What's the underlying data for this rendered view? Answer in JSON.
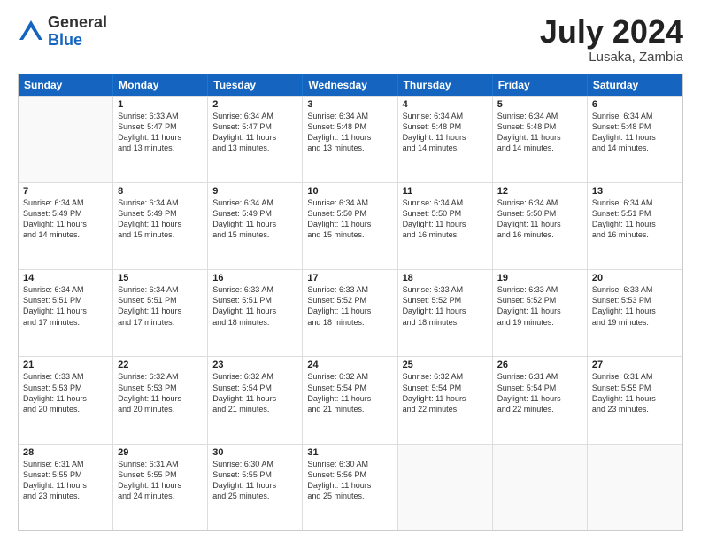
{
  "header": {
    "logo_general": "General",
    "logo_blue": "Blue",
    "month_year": "July 2024",
    "location": "Lusaka, Zambia"
  },
  "days_of_week": [
    "Sunday",
    "Monday",
    "Tuesday",
    "Wednesday",
    "Thursday",
    "Friday",
    "Saturday"
  ],
  "weeks": [
    [
      {
        "day": "",
        "lines": []
      },
      {
        "day": "1",
        "lines": [
          "Sunrise: 6:33 AM",
          "Sunset: 5:47 PM",
          "Daylight: 11 hours",
          "and 13 minutes."
        ]
      },
      {
        "day": "2",
        "lines": [
          "Sunrise: 6:34 AM",
          "Sunset: 5:47 PM",
          "Daylight: 11 hours",
          "and 13 minutes."
        ]
      },
      {
        "day": "3",
        "lines": [
          "Sunrise: 6:34 AM",
          "Sunset: 5:48 PM",
          "Daylight: 11 hours",
          "and 13 minutes."
        ]
      },
      {
        "day": "4",
        "lines": [
          "Sunrise: 6:34 AM",
          "Sunset: 5:48 PM",
          "Daylight: 11 hours",
          "and 14 minutes."
        ]
      },
      {
        "day": "5",
        "lines": [
          "Sunrise: 6:34 AM",
          "Sunset: 5:48 PM",
          "Daylight: 11 hours",
          "and 14 minutes."
        ]
      },
      {
        "day": "6",
        "lines": [
          "Sunrise: 6:34 AM",
          "Sunset: 5:48 PM",
          "Daylight: 11 hours",
          "and 14 minutes."
        ]
      }
    ],
    [
      {
        "day": "7",
        "lines": [
          "Sunrise: 6:34 AM",
          "Sunset: 5:49 PM",
          "Daylight: 11 hours",
          "and 14 minutes."
        ]
      },
      {
        "day": "8",
        "lines": [
          "Sunrise: 6:34 AM",
          "Sunset: 5:49 PM",
          "Daylight: 11 hours",
          "and 15 minutes."
        ]
      },
      {
        "day": "9",
        "lines": [
          "Sunrise: 6:34 AM",
          "Sunset: 5:49 PM",
          "Daylight: 11 hours",
          "and 15 minutes."
        ]
      },
      {
        "day": "10",
        "lines": [
          "Sunrise: 6:34 AM",
          "Sunset: 5:50 PM",
          "Daylight: 11 hours",
          "and 15 minutes."
        ]
      },
      {
        "day": "11",
        "lines": [
          "Sunrise: 6:34 AM",
          "Sunset: 5:50 PM",
          "Daylight: 11 hours",
          "and 16 minutes."
        ]
      },
      {
        "day": "12",
        "lines": [
          "Sunrise: 6:34 AM",
          "Sunset: 5:50 PM",
          "Daylight: 11 hours",
          "and 16 minutes."
        ]
      },
      {
        "day": "13",
        "lines": [
          "Sunrise: 6:34 AM",
          "Sunset: 5:51 PM",
          "Daylight: 11 hours",
          "and 16 minutes."
        ]
      }
    ],
    [
      {
        "day": "14",
        "lines": [
          "Sunrise: 6:34 AM",
          "Sunset: 5:51 PM",
          "Daylight: 11 hours",
          "and 17 minutes."
        ]
      },
      {
        "day": "15",
        "lines": [
          "Sunrise: 6:34 AM",
          "Sunset: 5:51 PM",
          "Daylight: 11 hours",
          "and 17 minutes."
        ]
      },
      {
        "day": "16",
        "lines": [
          "Sunrise: 6:33 AM",
          "Sunset: 5:51 PM",
          "Daylight: 11 hours",
          "and 18 minutes."
        ]
      },
      {
        "day": "17",
        "lines": [
          "Sunrise: 6:33 AM",
          "Sunset: 5:52 PM",
          "Daylight: 11 hours",
          "and 18 minutes."
        ]
      },
      {
        "day": "18",
        "lines": [
          "Sunrise: 6:33 AM",
          "Sunset: 5:52 PM",
          "Daylight: 11 hours",
          "and 18 minutes."
        ]
      },
      {
        "day": "19",
        "lines": [
          "Sunrise: 6:33 AM",
          "Sunset: 5:52 PM",
          "Daylight: 11 hours",
          "and 19 minutes."
        ]
      },
      {
        "day": "20",
        "lines": [
          "Sunrise: 6:33 AM",
          "Sunset: 5:53 PM",
          "Daylight: 11 hours",
          "and 19 minutes."
        ]
      }
    ],
    [
      {
        "day": "21",
        "lines": [
          "Sunrise: 6:33 AM",
          "Sunset: 5:53 PM",
          "Daylight: 11 hours",
          "and 20 minutes."
        ]
      },
      {
        "day": "22",
        "lines": [
          "Sunrise: 6:32 AM",
          "Sunset: 5:53 PM",
          "Daylight: 11 hours",
          "and 20 minutes."
        ]
      },
      {
        "day": "23",
        "lines": [
          "Sunrise: 6:32 AM",
          "Sunset: 5:54 PM",
          "Daylight: 11 hours",
          "and 21 minutes."
        ]
      },
      {
        "day": "24",
        "lines": [
          "Sunrise: 6:32 AM",
          "Sunset: 5:54 PM",
          "Daylight: 11 hours",
          "and 21 minutes."
        ]
      },
      {
        "day": "25",
        "lines": [
          "Sunrise: 6:32 AM",
          "Sunset: 5:54 PM",
          "Daylight: 11 hours",
          "and 22 minutes."
        ]
      },
      {
        "day": "26",
        "lines": [
          "Sunrise: 6:31 AM",
          "Sunset: 5:54 PM",
          "Daylight: 11 hours",
          "and 22 minutes."
        ]
      },
      {
        "day": "27",
        "lines": [
          "Sunrise: 6:31 AM",
          "Sunset: 5:55 PM",
          "Daylight: 11 hours",
          "and 23 minutes."
        ]
      }
    ],
    [
      {
        "day": "28",
        "lines": [
          "Sunrise: 6:31 AM",
          "Sunset: 5:55 PM",
          "Daylight: 11 hours",
          "and 23 minutes."
        ]
      },
      {
        "day": "29",
        "lines": [
          "Sunrise: 6:31 AM",
          "Sunset: 5:55 PM",
          "Daylight: 11 hours",
          "and 24 minutes."
        ]
      },
      {
        "day": "30",
        "lines": [
          "Sunrise: 6:30 AM",
          "Sunset: 5:55 PM",
          "Daylight: 11 hours",
          "and 25 minutes."
        ]
      },
      {
        "day": "31",
        "lines": [
          "Sunrise: 6:30 AM",
          "Sunset: 5:56 PM",
          "Daylight: 11 hours",
          "and 25 minutes."
        ]
      },
      {
        "day": "",
        "lines": []
      },
      {
        "day": "",
        "lines": []
      },
      {
        "day": "",
        "lines": []
      }
    ]
  ]
}
